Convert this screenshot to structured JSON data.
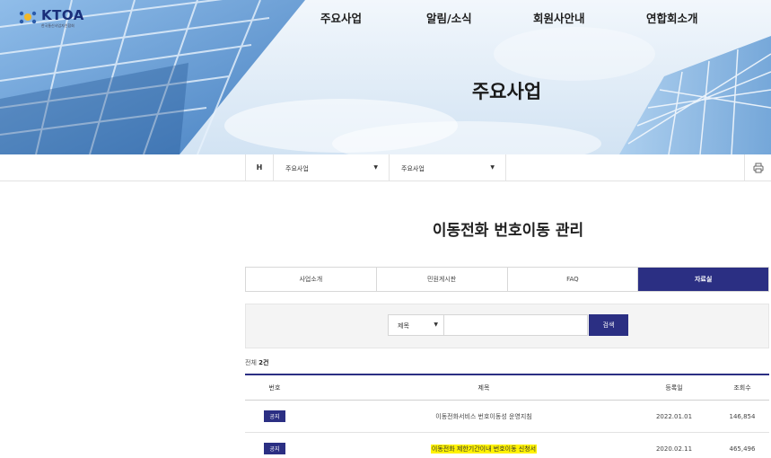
{
  "header": {
    "logo_text": "KTOA",
    "logo_subtext": "한국통신사업자연합회",
    "nav": [
      "주요사업",
      "알림/소식",
      "회원사안내",
      "연합회소개"
    ],
    "hero_title": "주요사업"
  },
  "location": {
    "home": "H",
    "select1": "주요사업",
    "select2": "주요사업"
  },
  "page_title": "이동전화 번호이동 관리",
  "tabs": [
    "사업소개",
    "민원게시판",
    "FAQ",
    "자료실"
  ],
  "active_tab": "자료실",
  "search": {
    "select_value": "제목",
    "input_value": "",
    "button_label": "검색"
  },
  "count": {
    "prefix": "전체",
    "value": "2건"
  },
  "table": {
    "headers": [
      "번호",
      "제목",
      "등록일",
      "조회수"
    ],
    "rows": [
      {
        "badge": "공지",
        "title": "이동전화서비스 번호이동성 운영지침",
        "date": "2022.01.01",
        "views": "146,854",
        "highlight": false
      },
      {
        "badge": "공지",
        "title": "이동전화 제한기간이내 번호이동 신청서",
        "date": "2020.02.11",
        "views": "465,496",
        "highlight": true
      }
    ]
  },
  "colors": {
    "accent": "#2b2f83",
    "highlight": "#fff200"
  }
}
